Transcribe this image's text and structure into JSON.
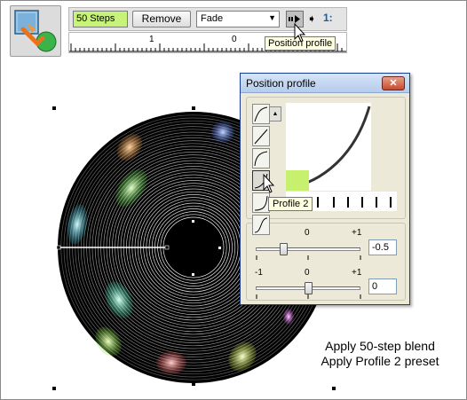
{
  "toolbar": {
    "steps_value": "50 Steps",
    "remove_label": "Remove",
    "fade_value": "Fade",
    "extra_icon": "1:"
  },
  "ruler": {
    "labels": [
      "1",
      "0"
    ]
  },
  "tooltip_toolbar": "Position profile",
  "dialog": {
    "title": "Position profile",
    "close_glyph": "✕",
    "profile_tooltip": "Profile 2",
    "slider1": {
      "min_label": "",
      "mid_label": "0",
      "max_label": "+1",
      "value": "-0.5"
    },
    "slider2": {
      "min_label": "-1",
      "mid_label": "0",
      "max_label": "+1",
      "value": "0"
    }
  },
  "caption": {
    "line1": "Apply 50-step blend",
    "line2": "Apply Profile 2 preset"
  },
  "icons": [
    "blend-tool-icon",
    "position-profile-icon",
    "arrow-icon",
    "cursor-icon",
    "dropdown-arrow-icon",
    "close-icon"
  ]
}
